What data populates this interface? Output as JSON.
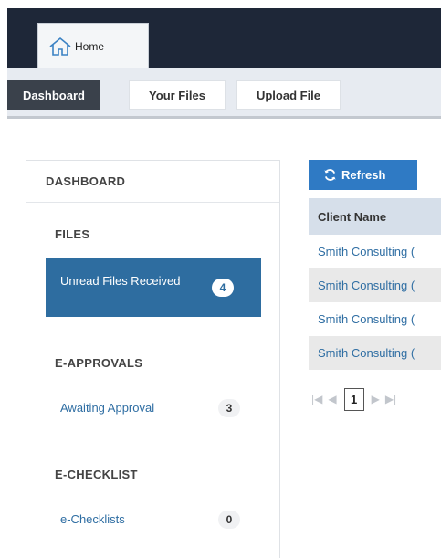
{
  "header": {
    "home_tab": "Home"
  },
  "nav": {
    "items": [
      "Dashboard",
      "Your Files",
      "Upload File"
    ]
  },
  "panel": {
    "title": "DASHBOARD",
    "files": {
      "title": "FILES",
      "unread_label": "Unread Files Received",
      "unread_count": "4"
    },
    "approvals": {
      "title": "E-APPROVALS",
      "awaiting_label": "Awaiting Approval",
      "awaiting_count": "3"
    },
    "checklist": {
      "title": "E-CHECKLIST",
      "label": "e-Checklists",
      "count": "0"
    }
  },
  "main": {
    "refresh_label": "Refresh",
    "table": {
      "header": "Client Name",
      "rows": [
        "Smith Consulting (",
        "Smith Consulting (",
        "Smith Consulting (",
        "Smith Consulting ("
      ]
    },
    "pager": {
      "current_page": "1"
    }
  },
  "colors": {
    "top_bar": "#1e2738",
    "active_nav": "#3a414b",
    "selected_item": "#2e6da0",
    "refresh_button": "#2f7ac4",
    "link": "#2f6ea3"
  }
}
